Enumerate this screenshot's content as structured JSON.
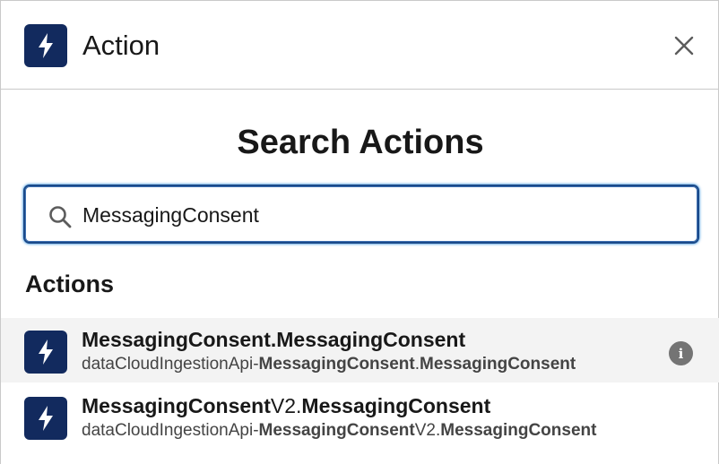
{
  "header": {
    "title": "Action",
    "icon": "lightning-bolt-icon",
    "close_icon": "close-icon"
  },
  "search": {
    "title": "Search Actions",
    "value": "MessagingConsent",
    "placeholder": ""
  },
  "results": {
    "heading": "Actions",
    "items": [
      {
        "title_bold": "MessagingConsent.MessagingConsent",
        "title_plain": "",
        "sub_prefix": "dataCloudIngestionApi-",
        "sub_bold1": "MessagingConsent",
        "sub_plain": ".",
        "sub_bold2": "MessagingConsent",
        "icon": "lightning-bolt-icon",
        "info_icon": "info-icon",
        "info_glyph": "i"
      },
      {
        "title_bold": "MessagingConsent",
        "title_plain": "V2.",
        "title_bold2": "MessagingConsent",
        "sub_prefix": "dataCloudIngestionApi-",
        "sub_bold1": "MessagingConsent",
        "sub_plain": "V2.",
        "sub_bold2": "MessagingConsent",
        "icon": "lightning-bolt-icon"
      }
    ]
  },
  "colors": {
    "tile": "#122a5e",
    "focus_border": "#1b4a8a",
    "highlight_row": "#f3f3f3",
    "info_icon": "#747474"
  }
}
